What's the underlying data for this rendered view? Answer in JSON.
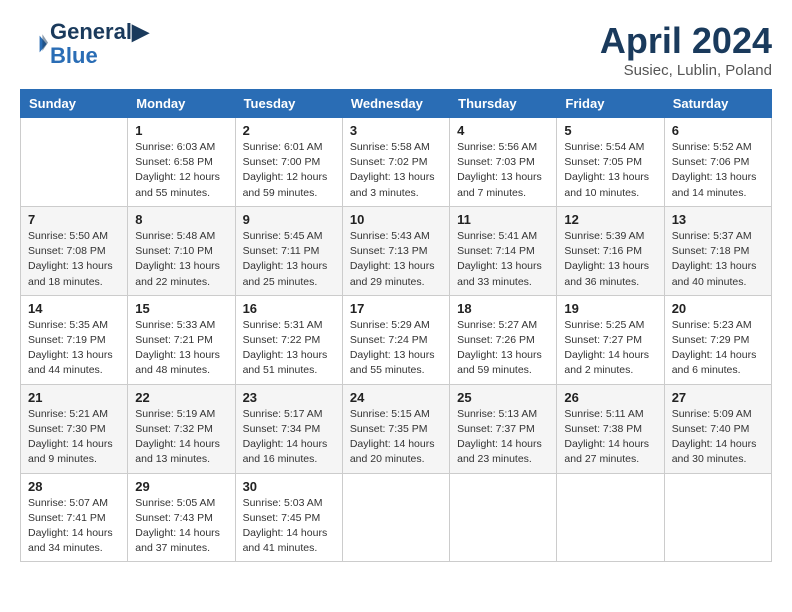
{
  "header": {
    "logo_line1": "General",
    "logo_line2": "Blue",
    "month": "April 2024",
    "location": "Susiec, Lublin, Poland"
  },
  "days_of_week": [
    "Sunday",
    "Monday",
    "Tuesday",
    "Wednesday",
    "Thursday",
    "Friday",
    "Saturday"
  ],
  "weeks": [
    [
      {
        "day": "",
        "info": ""
      },
      {
        "day": "1",
        "info": "Sunrise: 6:03 AM\nSunset: 6:58 PM\nDaylight: 12 hours\nand 55 minutes."
      },
      {
        "day": "2",
        "info": "Sunrise: 6:01 AM\nSunset: 7:00 PM\nDaylight: 12 hours\nand 59 minutes."
      },
      {
        "day": "3",
        "info": "Sunrise: 5:58 AM\nSunset: 7:02 PM\nDaylight: 13 hours\nand 3 minutes."
      },
      {
        "day": "4",
        "info": "Sunrise: 5:56 AM\nSunset: 7:03 PM\nDaylight: 13 hours\nand 7 minutes."
      },
      {
        "day": "5",
        "info": "Sunrise: 5:54 AM\nSunset: 7:05 PM\nDaylight: 13 hours\nand 10 minutes."
      },
      {
        "day": "6",
        "info": "Sunrise: 5:52 AM\nSunset: 7:06 PM\nDaylight: 13 hours\nand 14 minutes."
      }
    ],
    [
      {
        "day": "7",
        "info": "Sunrise: 5:50 AM\nSunset: 7:08 PM\nDaylight: 13 hours\nand 18 minutes."
      },
      {
        "day": "8",
        "info": "Sunrise: 5:48 AM\nSunset: 7:10 PM\nDaylight: 13 hours\nand 22 minutes."
      },
      {
        "day": "9",
        "info": "Sunrise: 5:45 AM\nSunset: 7:11 PM\nDaylight: 13 hours\nand 25 minutes."
      },
      {
        "day": "10",
        "info": "Sunrise: 5:43 AM\nSunset: 7:13 PM\nDaylight: 13 hours\nand 29 minutes."
      },
      {
        "day": "11",
        "info": "Sunrise: 5:41 AM\nSunset: 7:14 PM\nDaylight: 13 hours\nand 33 minutes."
      },
      {
        "day": "12",
        "info": "Sunrise: 5:39 AM\nSunset: 7:16 PM\nDaylight: 13 hours\nand 36 minutes."
      },
      {
        "day": "13",
        "info": "Sunrise: 5:37 AM\nSunset: 7:18 PM\nDaylight: 13 hours\nand 40 minutes."
      }
    ],
    [
      {
        "day": "14",
        "info": "Sunrise: 5:35 AM\nSunset: 7:19 PM\nDaylight: 13 hours\nand 44 minutes."
      },
      {
        "day": "15",
        "info": "Sunrise: 5:33 AM\nSunset: 7:21 PM\nDaylight: 13 hours\nand 48 minutes."
      },
      {
        "day": "16",
        "info": "Sunrise: 5:31 AM\nSunset: 7:22 PM\nDaylight: 13 hours\nand 51 minutes."
      },
      {
        "day": "17",
        "info": "Sunrise: 5:29 AM\nSunset: 7:24 PM\nDaylight: 13 hours\nand 55 minutes."
      },
      {
        "day": "18",
        "info": "Sunrise: 5:27 AM\nSunset: 7:26 PM\nDaylight: 13 hours\nand 59 minutes."
      },
      {
        "day": "19",
        "info": "Sunrise: 5:25 AM\nSunset: 7:27 PM\nDaylight: 14 hours\nand 2 minutes."
      },
      {
        "day": "20",
        "info": "Sunrise: 5:23 AM\nSunset: 7:29 PM\nDaylight: 14 hours\nand 6 minutes."
      }
    ],
    [
      {
        "day": "21",
        "info": "Sunrise: 5:21 AM\nSunset: 7:30 PM\nDaylight: 14 hours\nand 9 minutes."
      },
      {
        "day": "22",
        "info": "Sunrise: 5:19 AM\nSunset: 7:32 PM\nDaylight: 14 hours\nand 13 minutes."
      },
      {
        "day": "23",
        "info": "Sunrise: 5:17 AM\nSunset: 7:34 PM\nDaylight: 14 hours\nand 16 minutes."
      },
      {
        "day": "24",
        "info": "Sunrise: 5:15 AM\nSunset: 7:35 PM\nDaylight: 14 hours\nand 20 minutes."
      },
      {
        "day": "25",
        "info": "Sunrise: 5:13 AM\nSunset: 7:37 PM\nDaylight: 14 hours\nand 23 minutes."
      },
      {
        "day": "26",
        "info": "Sunrise: 5:11 AM\nSunset: 7:38 PM\nDaylight: 14 hours\nand 27 minutes."
      },
      {
        "day": "27",
        "info": "Sunrise: 5:09 AM\nSunset: 7:40 PM\nDaylight: 14 hours\nand 30 minutes."
      }
    ],
    [
      {
        "day": "28",
        "info": "Sunrise: 5:07 AM\nSunset: 7:41 PM\nDaylight: 14 hours\nand 34 minutes."
      },
      {
        "day": "29",
        "info": "Sunrise: 5:05 AM\nSunset: 7:43 PM\nDaylight: 14 hours\nand 37 minutes."
      },
      {
        "day": "30",
        "info": "Sunrise: 5:03 AM\nSunset: 7:45 PM\nDaylight: 14 hours\nand 41 minutes."
      },
      {
        "day": "",
        "info": ""
      },
      {
        "day": "",
        "info": ""
      },
      {
        "day": "",
        "info": ""
      },
      {
        "day": "",
        "info": ""
      }
    ]
  ]
}
